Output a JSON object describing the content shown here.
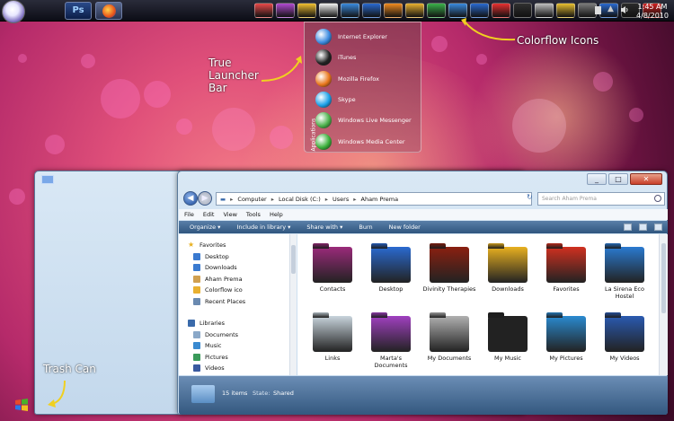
{
  "taskbar": {
    "photoshop_label": "Ps",
    "clock_time": "1:45 AM",
    "clock_date": "4/8/2010",
    "dock_colors": [
      "#e84a4a",
      "#b04ad0",
      "#f0c030",
      "#f2f2f2",
      "#3a8adf",
      "#2a6ad0",
      "#f08a20",
      "#e8b030",
      "#3ab04a",
      "#3a8adf",
      "#2a6ad0",
      "#e83030",
      "#303030",
      "#c0c0c0",
      "#e8c030",
      "#7a7a7a",
      "#2a6ad0",
      "#2a2a2a",
      "#d02020"
    ]
  },
  "launcher": {
    "section_title": "Applications",
    "items": [
      {
        "label": "Internet Explorer",
        "color": "#3a8adf"
      },
      {
        "label": "iTunes",
        "color": "#222222"
      },
      {
        "label": "Mozilla Firefox",
        "color": "#e8761a"
      },
      {
        "label": "Skype",
        "color": "#1aa0e8"
      },
      {
        "label": "Windows Live Messenger",
        "color": "#4ab04a"
      },
      {
        "label": "Windows Media Center",
        "color": "#3ab03a"
      }
    ]
  },
  "annotations": {
    "launcher_bar": "True Launcher Bar",
    "colorflow": "Colorflow Icons",
    "trash": "Trash Can"
  },
  "explorer": {
    "breadcrumb": [
      "Computer",
      "Local Disk (C:)",
      "Users",
      "Aham Prema"
    ],
    "search_placeholder": "Search Aham Prema",
    "menu": [
      "File",
      "Edit",
      "View",
      "Tools",
      "Help"
    ],
    "commands": [
      "Organize ▾",
      "Include in library ▾",
      "Share with ▾",
      "Burn",
      "New folder"
    ],
    "nav": {
      "favorites_header": "Favorites",
      "favorites": [
        "Desktop",
        "Downloads",
        "Aham Prema",
        "Colorflow ico",
        "Recent Places"
      ],
      "libraries_header": "Libraries",
      "libraries": [
        "Documents",
        "Music",
        "Pictures",
        "Videos"
      ]
    },
    "folders": [
      {
        "label": "Contacts",
        "color": "#9a2a7a"
      },
      {
        "label": "Desktop",
        "color": "#2a6ad0"
      },
      {
        "label": "Divinity Therapies",
        "color": "#8a2010"
      },
      {
        "label": "Downloads",
        "color": "#e8b020"
      },
      {
        "label": "Favorites",
        "color": "#d03020"
      },
      {
        "label": "La Sirena Eco Hostel",
        "color": "#2a7ad0"
      },
      {
        "label": "Links",
        "color": "#c8d4dc"
      },
      {
        "label": "Marta's Documents",
        "color": "#a040c0"
      },
      {
        "label": "My Documents",
        "color": "#b0b0b0"
      },
      {
        "label": "My Music",
        "color": "#222222"
      },
      {
        "label": "My Pictures",
        "color": "#2a8ad0"
      },
      {
        "label": "My Videos",
        "color": "#2a5ab0"
      }
    ],
    "item_count": "15 items",
    "state_label": "State:",
    "state_value": "Shared"
  }
}
